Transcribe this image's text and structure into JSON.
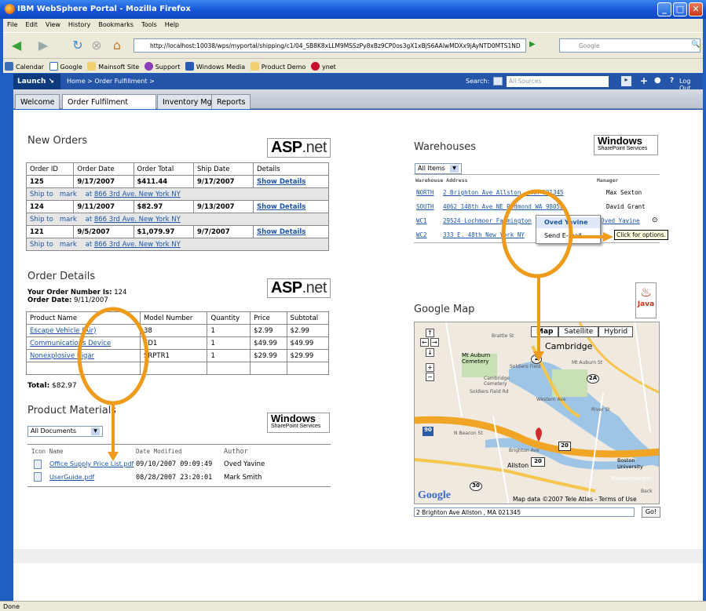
{
  "window": {
    "title": "IBM WebSphere Portal - Mozilla Firefox"
  },
  "menu": [
    "File",
    "Edit",
    "View",
    "History",
    "Bookmarks",
    "Tools",
    "Help"
  ],
  "url": "http://localhost:10038/wps/myportal/shipping/c1/04_SB8K8xLLM9MSSzPy8xBz9CP0os3gX1xBjS6AAIwMDXx9jAyNTD0MTS1ND",
  "google_placeholder": "Google",
  "bookmarks": [
    "Calendar",
    "Google",
    "Mainsoft Site",
    "Support",
    "Windows Media",
    "Product Demo",
    "ynet"
  ],
  "portal": {
    "launch": "Launch",
    "breadcrumb": "Home > Order Fulfillment >",
    "search_label": "Search:",
    "search_scope": "All Sources",
    "logout": "Log Out"
  },
  "tabs": [
    "Welcome",
    "Order Fulfilment",
    "Inventory Mgmt",
    "Reports"
  ],
  "new_orders": {
    "title": "New Orders",
    "logo": "ASP.net",
    "headers": [
      "Order ID",
      "Order Date",
      "Order Total",
      "Ship Date",
      "Details"
    ],
    "rows": [
      {
        "id": "125",
        "date": "9/17/2007",
        "total": "$411.44",
        "ship": "9/17/2007",
        "details": "Show Details",
        "ship_to": "Ship to",
        "name": "mark",
        "at": "at",
        "address": "866 3rd Ave. New York NY"
      },
      {
        "id": "124",
        "date": "9/11/2007",
        "total": "$82.97",
        "ship": "9/13/2007",
        "details": "Show Details",
        "ship_to": "Ship to",
        "name": "mark",
        "at": "at",
        "address": "866 3rd Ave. New York NY"
      },
      {
        "id": "121",
        "date": "9/5/2007",
        "total": "$1,079.97",
        "ship": "9/7/2007",
        "details": "Show Details",
        "ship_to": "Ship to",
        "name": "mark",
        "at": "at",
        "address": "866 3rd Ave. New York NY"
      }
    ]
  },
  "order_details": {
    "title": "Order Details",
    "number_label": "Your Order Number Is:",
    "number": "124",
    "date_label": "Order Date:",
    "date": "9/11/2007",
    "headers": [
      "Product Name",
      "Model Number",
      "Quantity",
      "Price",
      "Subtotal"
    ],
    "rows": [
      {
        "name": "Escape Vehicle (Air)",
        "model": "38",
        "qty": "1",
        "price": "$2.99",
        "subtotal": "$2.99"
      },
      {
        "name": "Communications Device",
        "model": "ED1",
        "qty": "1",
        "price": "$49.99",
        "subtotal": "$49.99"
      },
      {
        "name": "Nonexplosive Cigar",
        "model": "SRPTR1",
        "qty": "1",
        "price": "$29.99",
        "subtotal": "$29.99"
      }
    ],
    "total_label": "Total:",
    "total": "$82.97"
  },
  "product_materials": {
    "title": "Product Materials",
    "filter": "All Documents",
    "headers": [
      "Icon",
      "Name",
      "Date Modified",
      "Author"
    ],
    "rows": [
      {
        "name": "Office Supply Price List.pdf",
        "date": "09/10/2007 09:09:49",
        "author": "Oved Yavine"
      },
      {
        "name": "UserGuide.pdf",
        "date": "08/28/2007 23:20:01",
        "author": "Mark Smith"
      }
    ]
  },
  "sharepoint_logo": {
    "line1": "Windows",
    "line2": "SharePoint Services"
  },
  "warehouses": {
    "title": "Warehouses",
    "filter": "All Items",
    "headers": [
      "Warehouse",
      "Address",
      "Manager"
    ],
    "rows": [
      {
        "code": "NORTH",
        "address": "2 Brighton Ave Allston , MA 021345",
        "manager": "Max Sexton"
      },
      {
        "code": "SOUTH",
        "address": "4062 148th Ave NE Redmond WA 98052",
        "manager": "David Grant"
      },
      {
        "code": "WC1",
        "address": "29524 Lochmoor Farmington",
        "manager": "Oved Yavine"
      },
      {
        "code": "WC2",
        "address": "333 E. 48th New York NY",
        "manager": ""
      }
    ],
    "popup": {
      "name": "Oved Yavine",
      "action": "Send E-mail..."
    },
    "tooltip": "Click for options."
  },
  "google_map": {
    "title": "Google Map",
    "logo": "Java",
    "buttons": [
      "Map",
      "Satellite",
      "Hybrid"
    ],
    "labels": [
      "Cambridge",
      "Mt Auburn Cemetery",
      "Soldiers Field",
      "Cambridge Cemetery",
      "Western Ave",
      "Soldiers Field Rd",
      "River St",
      "N Beacon St",
      "Brighton Ave",
      "Allston",
      "Boston University",
      "Massachusetts",
      "Brattle St",
      "Mt Auburn St",
      "Back"
    ],
    "roads": [
      "2",
      "2A",
      "20",
      "90",
      "30",
      "20"
    ],
    "attribution": "Map data ©2007 Tele Atlas - Terms of Use",
    "google": "Google",
    "address": "2 Brighton Ave Allston , MA 021345",
    "go": "Go!"
  },
  "status": "Done",
  "colors": {
    "annotation": "#ee9a1a",
    "link": "#1a55a8",
    "portal_bar": "#2555a8"
  }
}
